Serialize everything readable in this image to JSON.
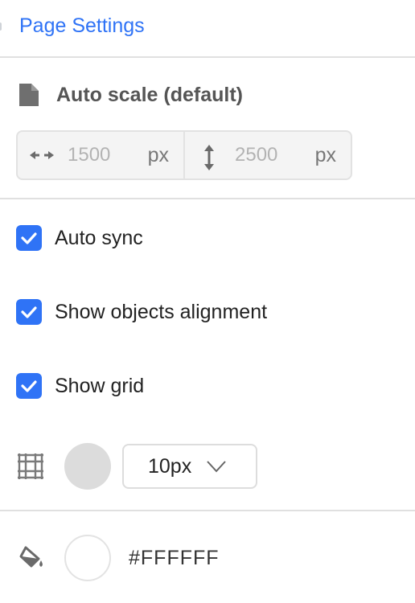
{
  "header": {
    "title": "Page Settings"
  },
  "size": {
    "scale_label": "Auto scale (default)",
    "width_value": "1500",
    "width_unit": "px",
    "height_value": "2500",
    "height_unit": "px"
  },
  "options": [
    {
      "label": "Auto sync",
      "checked": true
    },
    {
      "label": "Show objects alignment",
      "checked": true
    },
    {
      "label": "Show grid",
      "checked": true
    }
  ],
  "grid": {
    "icon": "grid-icon",
    "color": "#DCDCDC",
    "size_value": "10px"
  },
  "background": {
    "icon": "fill-icon",
    "color": "#FFFFFF",
    "value": "#FFFFFF"
  },
  "colors": {
    "accent": "#2F73F6"
  }
}
